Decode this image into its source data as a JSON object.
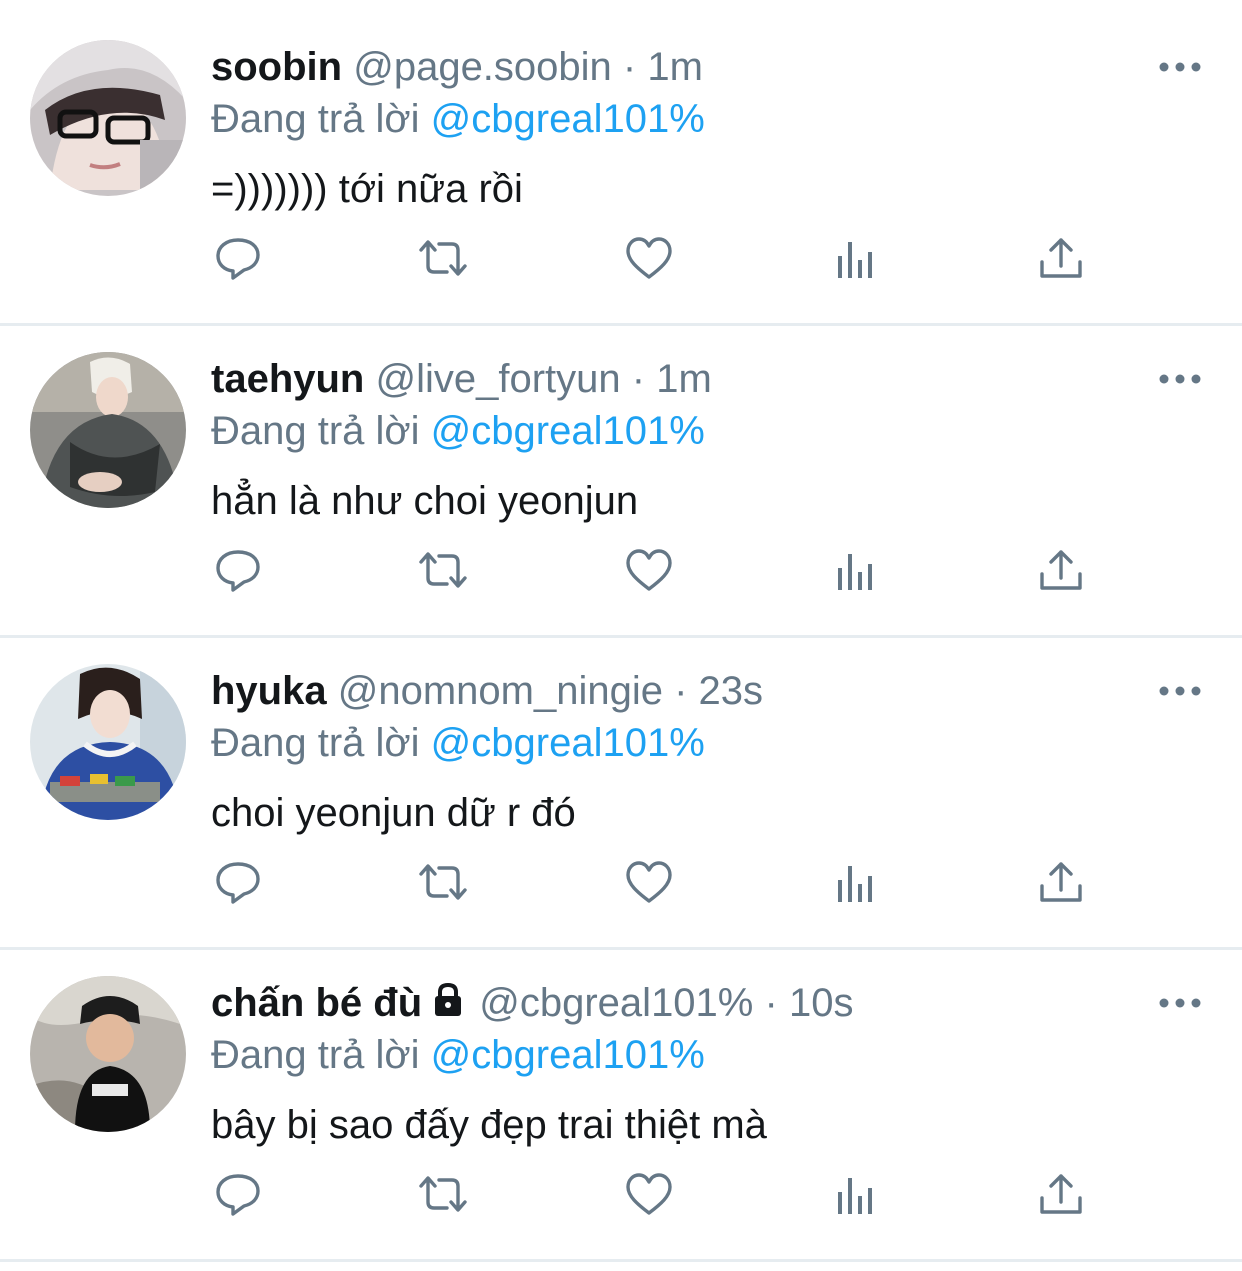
{
  "colors": {
    "text": "#14171a",
    "secondary": "#657786",
    "link": "#1da1f2",
    "icon": "#657786",
    "separator": "#e6ecf0"
  },
  "tweets": [
    {
      "name": "soobin",
      "handle": "@page.soobin",
      "separator": "·",
      "time": "1m",
      "reply_label": "Đang trả lời",
      "reply_to": "@cbgreal101%",
      "text": "=))))))) tới nữa rồi",
      "protected": false,
      "avatar": "avatar-photo"
    },
    {
      "name": "taehyun",
      "handle": "@live_fortyun",
      "separator": "·",
      "time": "1m",
      "reply_label": "Đang trả lời",
      "reply_to": "@cbgreal101%",
      "text": "hẳn là như choi yeonjun",
      "protected": false,
      "avatar": "avatar-photo"
    },
    {
      "name": "hyuka",
      "handle": "@nomnom_ningie",
      "separator": "·",
      "time": "23s",
      "reply_label": "Đang trả lời",
      "reply_to": "@cbgreal101%",
      "text": "choi yeonjun dữ r đó",
      "protected": false,
      "avatar": "avatar-photo"
    },
    {
      "name": "chấn bé đù",
      "handle": "@cbgreal101%",
      "separator": "·",
      "time": "10s",
      "reply_label": "Đang trả lời",
      "reply_to": "@cbgreal101%",
      "text": "bây bị sao đấy đẹp trai thiệt mà",
      "protected": true,
      "avatar": "avatar-photo"
    }
  ],
  "action_icons": [
    "reply-icon",
    "retweet-icon",
    "like-icon",
    "analytics-icon",
    "share-icon"
  ]
}
